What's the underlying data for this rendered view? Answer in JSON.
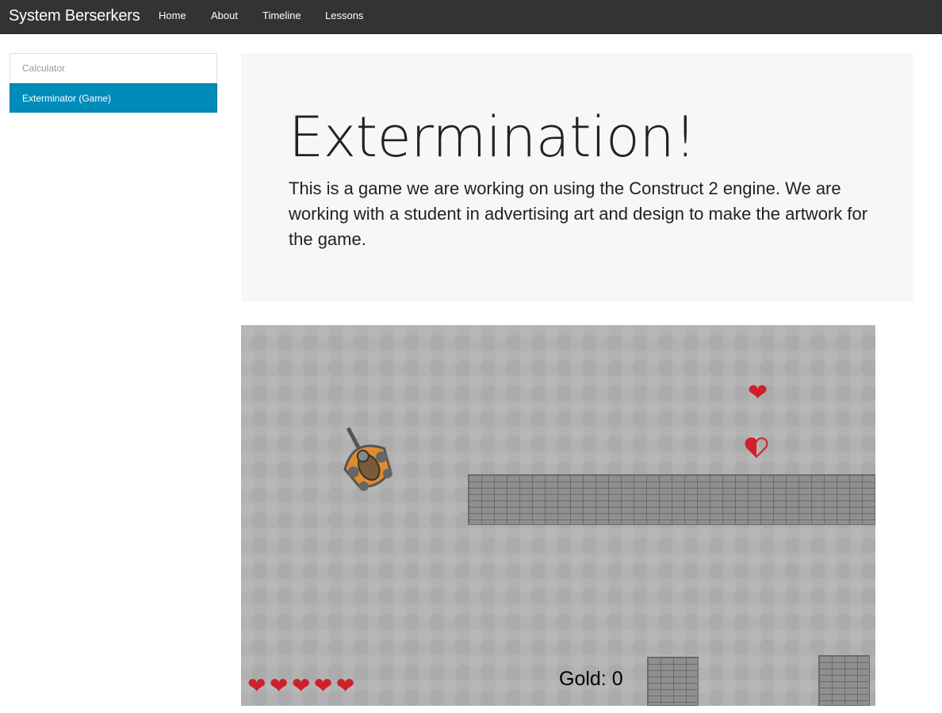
{
  "navbar": {
    "brand": "System Berserkers",
    "items": [
      {
        "label": "Home"
      },
      {
        "label": "About"
      },
      {
        "label": "Timeline"
      },
      {
        "label": "Lessons"
      }
    ]
  },
  "sidebar": {
    "items": [
      {
        "label": "Calculator",
        "active": false
      },
      {
        "label": "Exterminator (Game)",
        "active": true
      }
    ]
  },
  "jumbotron": {
    "title": "Extermination!",
    "text": "This is a game we are working on using the Construct 2 engine. We are working with a student in advertising art and design to make the artwork for the game."
  },
  "game": {
    "gold_label": "Gold: 0",
    "lives": 5,
    "colors": {
      "background": "#b2b2b2",
      "heart": "#d0202a",
      "bug_shell": "#e08a2e",
      "brick": "#8f8f8f"
    }
  }
}
